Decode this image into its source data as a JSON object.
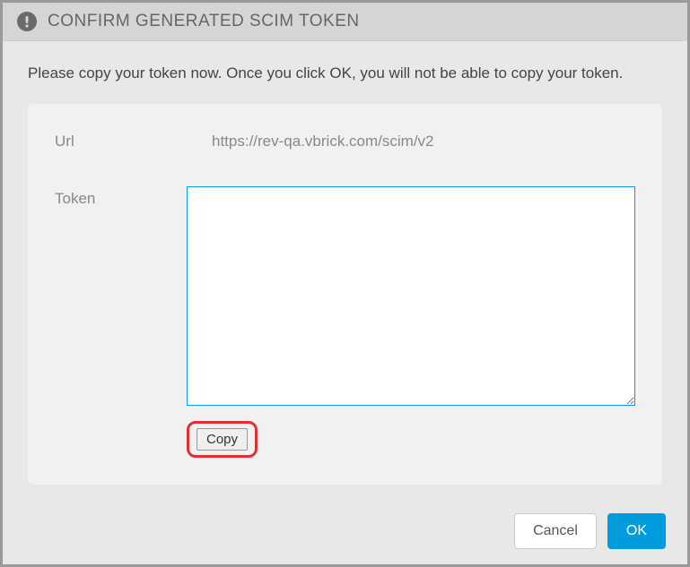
{
  "modal": {
    "title": "CONFIRM GENERATED SCIM TOKEN",
    "instruction": "Please copy your token now. Once you click OK, you will not be able to copy your token.",
    "fields": {
      "url_label": "Url",
      "url_value": "https://rev-qa.vbrick.com/scim/v2",
      "token_label": "Token",
      "token_value": ""
    },
    "buttons": {
      "copy": "Copy",
      "cancel": "Cancel",
      "ok": "OK"
    }
  }
}
